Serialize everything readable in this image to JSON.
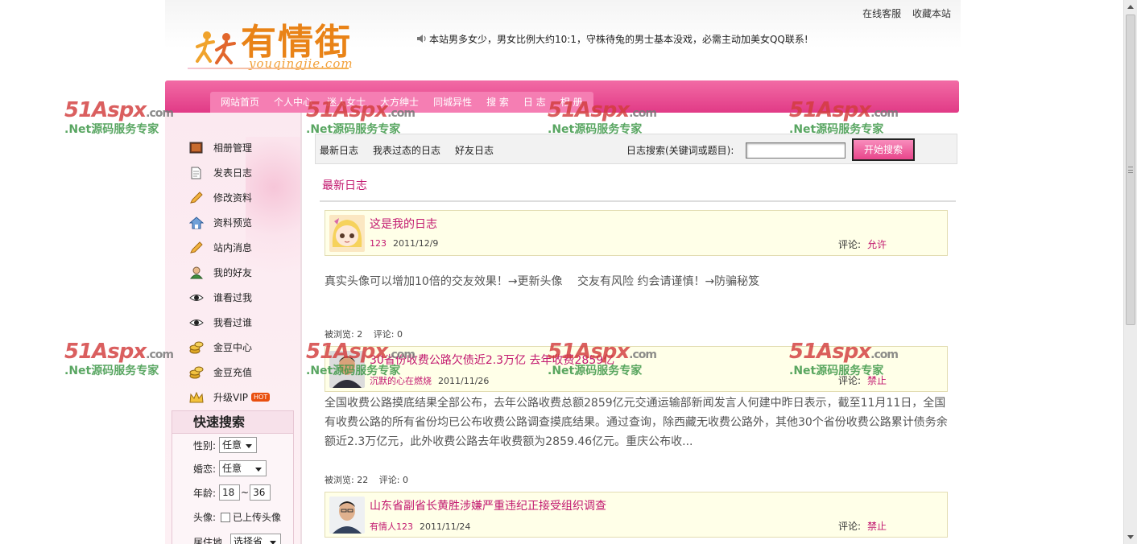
{
  "header": {
    "links": [
      "在线客服",
      "收藏本站"
    ],
    "logo_cn": "有情街",
    "logo_en": "youqingjie.com",
    "notice": "本站男多女少，男女比例大约10:1，守株待兔的男士基本没戏，必需主动加美女QQ联系!"
  },
  "nav": {
    "items": [
      "网站首页",
      "个人中心",
      "迷人女士",
      "大方绅士",
      "同城异性",
      "搜 索",
      "日 志",
      "相 册"
    ]
  },
  "sidebar": {
    "menu": [
      {
        "label": "相册管理",
        "icon": "photo-icon"
      },
      {
        "label": "发表日志",
        "icon": "document-icon"
      },
      {
        "label": "修改资料",
        "icon": "pencil-icon"
      },
      {
        "label": "资料预览",
        "icon": "home-icon"
      },
      {
        "label": "站内消息",
        "icon": "pencil-icon"
      },
      {
        "label": "我的好友",
        "icon": "user-icon"
      },
      {
        "label": "谁看过我",
        "icon": "eye-icon"
      },
      {
        "label": "我看过谁",
        "icon": "eye-icon"
      },
      {
        "label": "金豆中心",
        "icon": "coins-icon"
      },
      {
        "label": "金豆充值",
        "icon": "coins-icon"
      },
      {
        "label": "升级VIP",
        "icon": "crown-icon",
        "badge": "HOT"
      }
    ],
    "quick_search": {
      "title": "快速搜索",
      "gender_label": "性别:",
      "gender_value": "任意",
      "marital_label": "婚恋:",
      "marital_value": "任意",
      "age_label": "年龄:",
      "age_from": "18",
      "age_sep": "~",
      "age_to": "36",
      "avatar_label": "头像:",
      "avatar_checkbox": "已上传头像",
      "residence_label": "居住地",
      "residence_value": "选择省"
    }
  },
  "main": {
    "tabs": [
      "最新日志",
      "我表过态的日志",
      "好友日志"
    ],
    "search_label": "日志搜索(关键词或题目):",
    "search_value": "",
    "search_button": "开始搜索",
    "section_title": "最新日志",
    "comment_label": "评论:",
    "views_label": "被浏览:",
    "comments_label": "评论:",
    "entries": [
      {
        "title": "这是我的日志",
        "author": "123",
        "date": "2011/12/9",
        "comment_setting": "允许",
        "body": "真实头像可以增加10倍的交友效果！→更新头像　 交友有风险 约会请谨慎！→防骗秘笈",
        "views": "2",
        "comments": "0"
      },
      {
        "title": "30省份收费公路欠债近2.3万亿 去年收费2859亿",
        "author": "沉默的心在燃烧",
        "date": "2011/11/26",
        "comment_setting": "禁止",
        "body": "全国收费公路摸底结果全部公布，去年公路收费总额2859亿元交通运输部新闻发言人何建中昨日表示，截至11月11日，全国有收费公路的所有省份均已公布收费公路调查摸底结果。通过查询，除西藏无收费公路外，其他30个省份收费公路累计债务余额近2.3万亿元，此外收费公路去年收费额为2859.46亿元。重庆公布收...",
        "views": "22",
        "comments": "0"
      },
      {
        "title": "山东省副省长黄胜涉嫌严重违纪正接受组织调查",
        "author": "有情人123",
        "date": "2011/11/24",
        "comment_setting": "禁止"
      }
    ]
  },
  "watermark": {
    "brand": "51Aspx",
    "domain": ".com",
    "tagline": ".Net源码服务专家"
  },
  "colors": {
    "accent_pink": "#e13a86",
    "title_magenta": "#c2186f",
    "logo_orange": "#e98317"
  }
}
